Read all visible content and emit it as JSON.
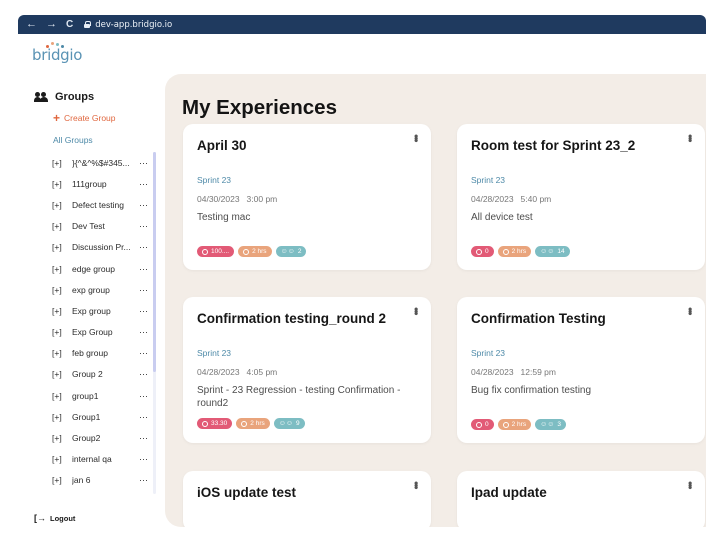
{
  "browser": {
    "url": "dev-app.bridgio.io",
    "back": "←",
    "forward": "→",
    "reload": "C"
  },
  "logo": {
    "text": "bridgio"
  },
  "sidebar": {
    "groups_title": "Groups",
    "create_group": "Create Group",
    "all_groups": "All Groups",
    "items": [
      {
        "expand": "[+]",
        "label": "}{^&^%$#345...",
        "more": "···"
      },
      {
        "expand": "[+]",
        "label": "111group",
        "more": "···"
      },
      {
        "expand": "[+]",
        "label": "Defect testing",
        "more": "···"
      },
      {
        "expand": "[+]",
        "label": "Dev Test",
        "more": "···"
      },
      {
        "expand": "[+]",
        "label": "Discussion Pr...",
        "more": "···"
      },
      {
        "expand": "[+]",
        "label": "edge group",
        "more": "···"
      },
      {
        "expand": "[+]",
        "label": "exp group",
        "more": "···"
      },
      {
        "expand": "[+]",
        "label": "Exp group",
        "more": "···"
      },
      {
        "expand": "[+]",
        "label": "Exp Group",
        "more": "···"
      },
      {
        "expand": "[+]",
        "label": "feb group",
        "more": "···"
      },
      {
        "expand": "[+]",
        "label": "Group 2",
        "more": "···"
      },
      {
        "expand": "[+]",
        "label": "group1",
        "more": "···"
      },
      {
        "expand": "[+]",
        "label": "Group1",
        "more": "···"
      },
      {
        "expand": "[+]",
        "label": "Group2",
        "more": "···"
      },
      {
        "expand": "[+]",
        "label": "internal qa",
        "more": "···"
      },
      {
        "expand": "[+]",
        "label": "jan 6",
        "more": "···"
      }
    ],
    "logout": "Logout"
  },
  "main": {
    "title": "My Experiences",
    "cards": [
      {
        "title": "April 30",
        "sprint": "Sprint 23",
        "date": "04/30/2023",
        "time": "3:00 pm",
        "description": "Testing mac",
        "progress": "100....",
        "duration": "2 hrs",
        "members": "2"
      },
      {
        "title": "Room test for Sprint 23_2",
        "sprint": "Sprint 23",
        "date": "04/28/2023",
        "time": "5:40 pm",
        "description": "All device test",
        "progress": "0",
        "duration": "2 hrs",
        "members": "14"
      },
      {
        "title": "Confirmation testing_round 2",
        "sprint": "Sprint 23",
        "date": "04/28/2023",
        "time": "4:05 pm",
        "description": "Sprint - 23 Regression - testing Confirmation - round2",
        "progress": "33.30",
        "duration": "2 hrs",
        "members": "9"
      },
      {
        "title": "Confirmation Testing",
        "sprint": "Sprint 23",
        "date": "04/28/2023",
        "time": "12:59 pm",
        "description": "Bug fix confirmation testing",
        "progress": "0",
        "duration": "2 hrs",
        "members": "3"
      },
      {
        "title": "iOS update test"
      },
      {
        "title": "Ipad update"
      }
    ]
  },
  "colors": {
    "accent_orange": "#e0673f",
    "link_blue": "#4e8aa8",
    "progress_badge": "#e25a76",
    "duration_badge": "#e9a47c",
    "members_badge": "#7dbdc3",
    "panel_bg": "#f3ede7",
    "browser_bar": "#1f3a5f"
  },
  "icons": {
    "groups": "people-icon",
    "create": "plus-icon",
    "logout": "logout-icon",
    "progress": "gauge-icon",
    "duration": "alarm-clock-icon",
    "members": "people-icon",
    "card_menu": "kebab-menu-icon"
  }
}
